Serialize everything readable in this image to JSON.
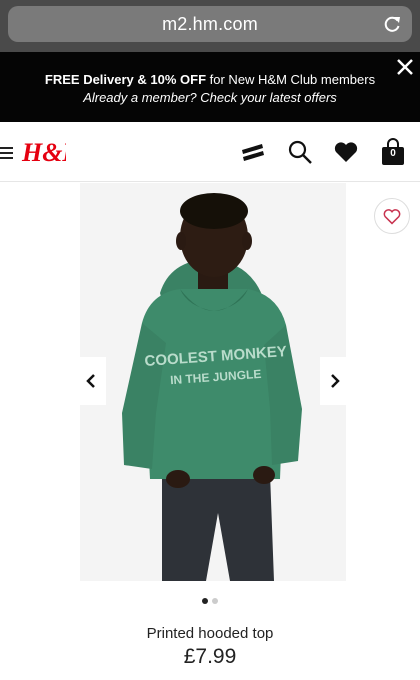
{
  "browser": {
    "url": "m2.hm.com"
  },
  "promo": {
    "line1_bold": "FREE Delivery & 10% OFF",
    "line1_rest": " for New H&M Club members",
    "line2": "Already a member? Check your latest offers"
  },
  "header": {
    "logo": "H&M",
    "bag_count": "0"
  },
  "product": {
    "name": "Printed hooded top",
    "price": "£7.99",
    "hoodie_print_line1": "COOLEST MONKEY",
    "hoodie_print_line2": "IN THE JUNGLE",
    "carousel": {
      "current": 1,
      "total": 2
    }
  },
  "colors": {
    "brand_red": "#e50010",
    "promo_bg": "#050505",
    "hoodie_green": "#3e8b6b",
    "jeans": "#2e3238"
  },
  "icons": [
    "reload-icon",
    "close-icon",
    "menu-icon",
    "store-locator-icon",
    "search-icon",
    "heart-icon",
    "shopping-bag-icon",
    "chevron-left-icon",
    "chevron-right-icon",
    "heart-outline-icon"
  ]
}
